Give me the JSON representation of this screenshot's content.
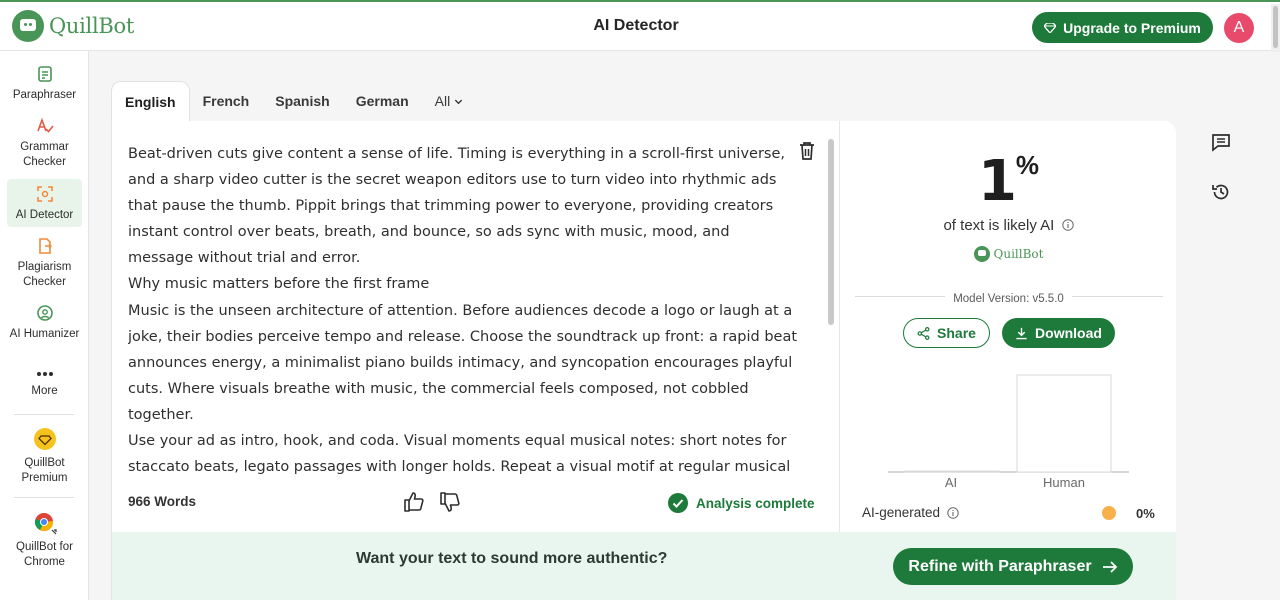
{
  "header": {
    "brand": "QuillBot",
    "title": "AI Detector",
    "upgrade_label": "Upgrade to Premium",
    "avatar_initial": "A",
    "accent": "#1d7a3a"
  },
  "sidebar": {
    "items": [
      {
        "label": "Paraphraser",
        "icon": "paraphraser-icon"
      },
      {
        "label": "Grammar Checker",
        "icon": "grammar-icon"
      },
      {
        "label": "AI Detector",
        "icon": "ai-detector-icon",
        "active": true
      },
      {
        "label": "Plagiarism Checker",
        "icon": "plagiarism-icon"
      },
      {
        "label": "AI Humanizer",
        "icon": "humanizer-icon"
      },
      {
        "label": "More",
        "icon": "more-icon"
      },
      {
        "label": "QuillBot Premium",
        "icon": "premium-icon"
      },
      {
        "label": "QuillBot for Chrome",
        "icon": "chrome-icon"
      }
    ]
  },
  "tabs": [
    {
      "label": "English",
      "active": true
    },
    {
      "label": "French"
    },
    {
      "label": "Spanish"
    },
    {
      "label": "German"
    },
    {
      "label": "All"
    }
  ],
  "editor": {
    "paragraphs": [
      "Beat-driven cuts give content a sense of life. Timing is everything in a scroll-first universe, and a sharp video cutter is the secret weapon editors use to turn video into rhythmic ads that pause the thumb. Pippit brings that trimming power to everyone, providing creators instant control over beats, breath, and bounce, so ads sync with music, mood, and message without trial and error.",
      "Why music matters before the first frame",
      "Music is the unseen architecture of attention. Before audiences decode a logo or laugh at a joke, their bodies perceive tempo and release. Choose the soundtrack up front: a rapid beat announces energy, a minimalist piano builds intimacy, and syncopation encourages playful cuts. Where visuals breathe with music, the commercial feels composed, not cobbled together.",
      "Use your ad as intro, hook, and coda. Visual moments equal musical notes: short notes for staccato beats, legato passages with longer holds. Repeat a visual motif at regular musical"
    ],
    "word_count": "966 Words",
    "status": "Analysis complete"
  },
  "results": {
    "percent": "1",
    "percent_sign": "%",
    "likely_text": "of text is likely AI",
    "brand": "QuillBot",
    "model_version": "Model Version: v5.5.0",
    "share_label": "Share",
    "download_label": "Download",
    "ai_generated_label": "AI-generated",
    "ai_generated_pct": "0%",
    "ai_dot_color": "#f7b04a"
  },
  "chart_data": {
    "type": "bar",
    "categories": [
      "AI",
      "Human"
    ],
    "values": [
      1,
      99
    ],
    "ylim": [
      0,
      100
    ],
    "grid": false
  },
  "banner": {
    "text": "Want your text to sound more authentic?",
    "button_label": "Refine with Paraphraser"
  }
}
